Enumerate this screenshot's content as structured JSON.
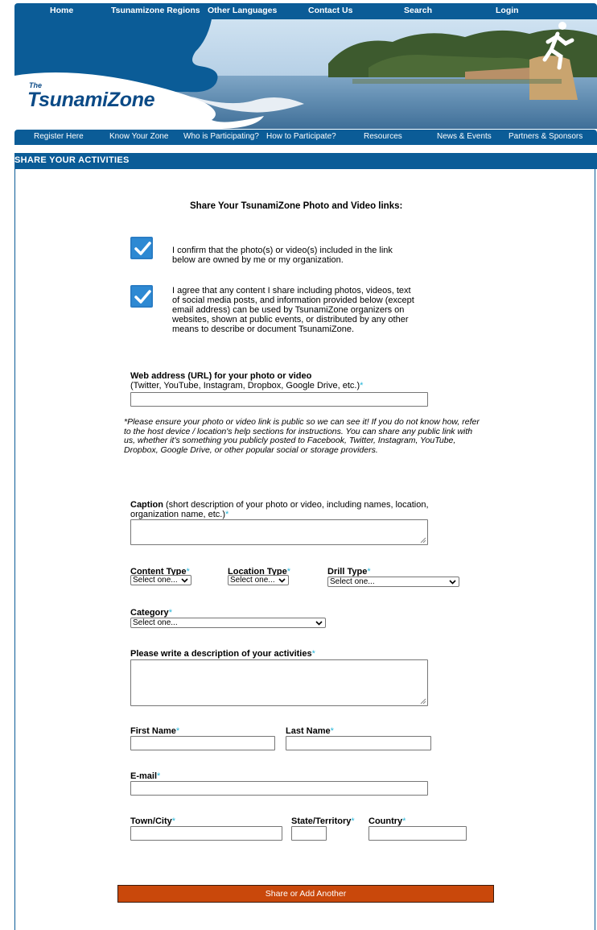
{
  "top_nav": {
    "items": [
      {
        "label": "Home"
      },
      {
        "label": "Tsunamizone Regions"
      },
      {
        "label": "Other Languages"
      },
      {
        "label": "Contact Us"
      },
      {
        "label": "Search"
      },
      {
        "label": "Login"
      }
    ]
  },
  "logo": {
    "the": "The",
    "name": "TsunamiZone"
  },
  "sub_nav": {
    "items": [
      {
        "label": "Register Here"
      },
      {
        "label": "Know Your Zone"
      },
      {
        "label": "Who is Participating?"
      },
      {
        "label": "How to Participate?"
      },
      {
        "label": "Resources"
      },
      {
        "label": "News & Events"
      },
      {
        "label": "Partners & Sponsors"
      }
    ]
  },
  "page_bar": {
    "title": "SHARE YOUR ACTIVITIES"
  },
  "form": {
    "title": "Share Your TsunamiZone Photo and Video links:",
    "checkbox1": {
      "text": "I confirm that the photo(s) or video(s) included in the link below are owned by me or my organization.",
      "checked": true
    },
    "checkbox2": {
      "text": "I agree that any content I share including photos, videos, text of social media posts, and information provided below (except email address) can be used by TsunamiZone organizers on websites, shown at public events, or distributed by any other means to describe or document TsunamiZone.",
      "checked": true
    },
    "url": {
      "label": "Web address (URL) for your photo or video",
      "hint": "(Twitter, YouTube, Instagram, Dropbox, Google Drive, etc.)",
      "required": "*",
      "value": ""
    },
    "note": "*Please ensure your photo or video link is public so we can see it! If you do not know how, refer to the host device / location's help sections for instructions. You can share any public link with us, whether it's something you publicly posted to Facebook, Twitter, Instagram, YouTube, Dropbox, Google Drive, or other popular social or storage providers.",
    "caption": {
      "label": "Caption",
      "hint": " (short description of your photo or video, including names, location, organization name, etc.)",
      "required": "*"
    },
    "content_type": {
      "label": "Content Type",
      "required": "*",
      "selected": "Select one..."
    },
    "location_type": {
      "label": "Location Type",
      "required": "*",
      "selected": "Select one..."
    },
    "drill_type": {
      "label": "Drill Type",
      "required": "*",
      "selected": "Select one..."
    },
    "category": {
      "label": "Category",
      "required": "*",
      "selected": "Select one..."
    },
    "description": {
      "label": "Please write a description of your activities",
      "required": "*"
    },
    "first_name": {
      "label": "First Name",
      "required": "*"
    },
    "last_name": {
      "label": "Last Name",
      "required": "*"
    },
    "email": {
      "label": "E-mail",
      "required": "*"
    },
    "town": {
      "label": "Town/City",
      "required": "*"
    },
    "state": {
      "label": "State/Territory",
      "required": "*"
    },
    "country": {
      "label": "Country",
      "required": "*"
    },
    "submit_label": "Share or Add Another"
  },
  "colors": {
    "nav_blue": "#0b5c97",
    "submit_orange": "#c9480b",
    "required_cyan": "#27b6d9",
    "checkbox_blue": "#2d89d3"
  }
}
